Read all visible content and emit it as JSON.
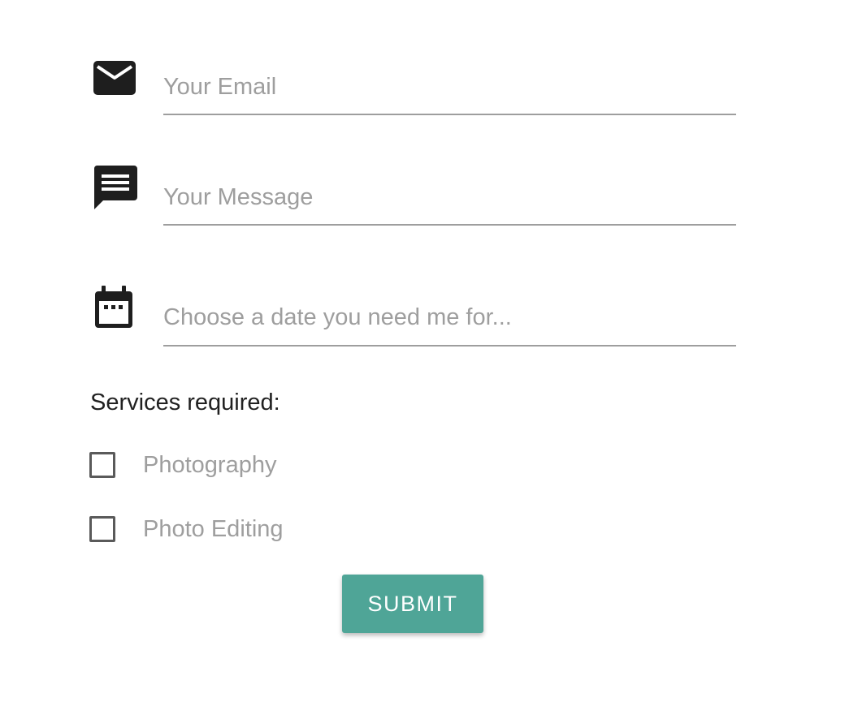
{
  "form": {
    "email": {
      "placeholder": "Your Email",
      "value": "",
      "icon": "email-icon"
    },
    "message": {
      "placeholder": "Your Message",
      "value": "",
      "icon": "message-icon"
    },
    "date": {
      "placeholder": "Choose a date you need me for...",
      "value": "",
      "icon": "calendar-icon"
    },
    "services_label": "Services required:",
    "services": [
      {
        "label": "Photography",
        "checked": false
      },
      {
        "label": "Photo Editing",
        "checked": false
      }
    ],
    "submit_label": "SUBMIT"
  },
  "colors": {
    "accent": "#4fa597",
    "placeholder": "#9e9e9e",
    "underline": "#9e9e9e",
    "icon": "#1e1e1e"
  }
}
